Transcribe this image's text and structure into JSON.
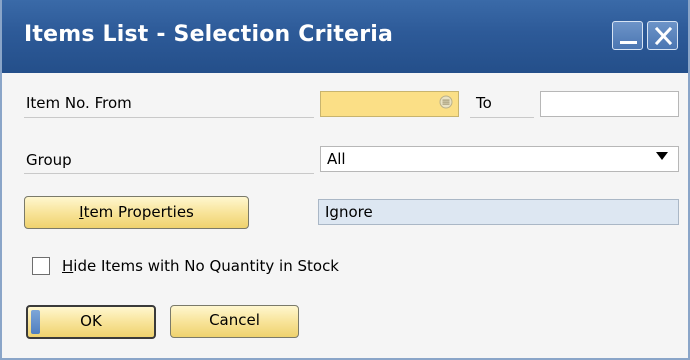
{
  "window": {
    "title": "Items List - Selection Criteria",
    "minimize_icon": "minimize-icon",
    "close_icon": "close-icon"
  },
  "item_no": {
    "label": "Item No. From",
    "from_value": "",
    "to_label": "To",
    "to_value": "",
    "link_icon": "link-arrow-icon"
  },
  "group": {
    "label": "Group",
    "value": "All",
    "arrow_icon": "dropdown-arrow-icon"
  },
  "properties": {
    "button_label_first": "I",
    "button_label_rest": "tem Properties",
    "value": "Ignore"
  },
  "hide_items": {
    "checked": false,
    "label_first": "H",
    "label_rest": "ide Items with No Quantity in Stock"
  },
  "buttons": {
    "ok_label": "OK",
    "cancel_label": "Cancel"
  },
  "colors": {
    "titlebar": "#2d5a98",
    "highlight_field": "#fbdf86",
    "readonly_field": "#dde7f2",
    "button": "#f8e49a"
  }
}
